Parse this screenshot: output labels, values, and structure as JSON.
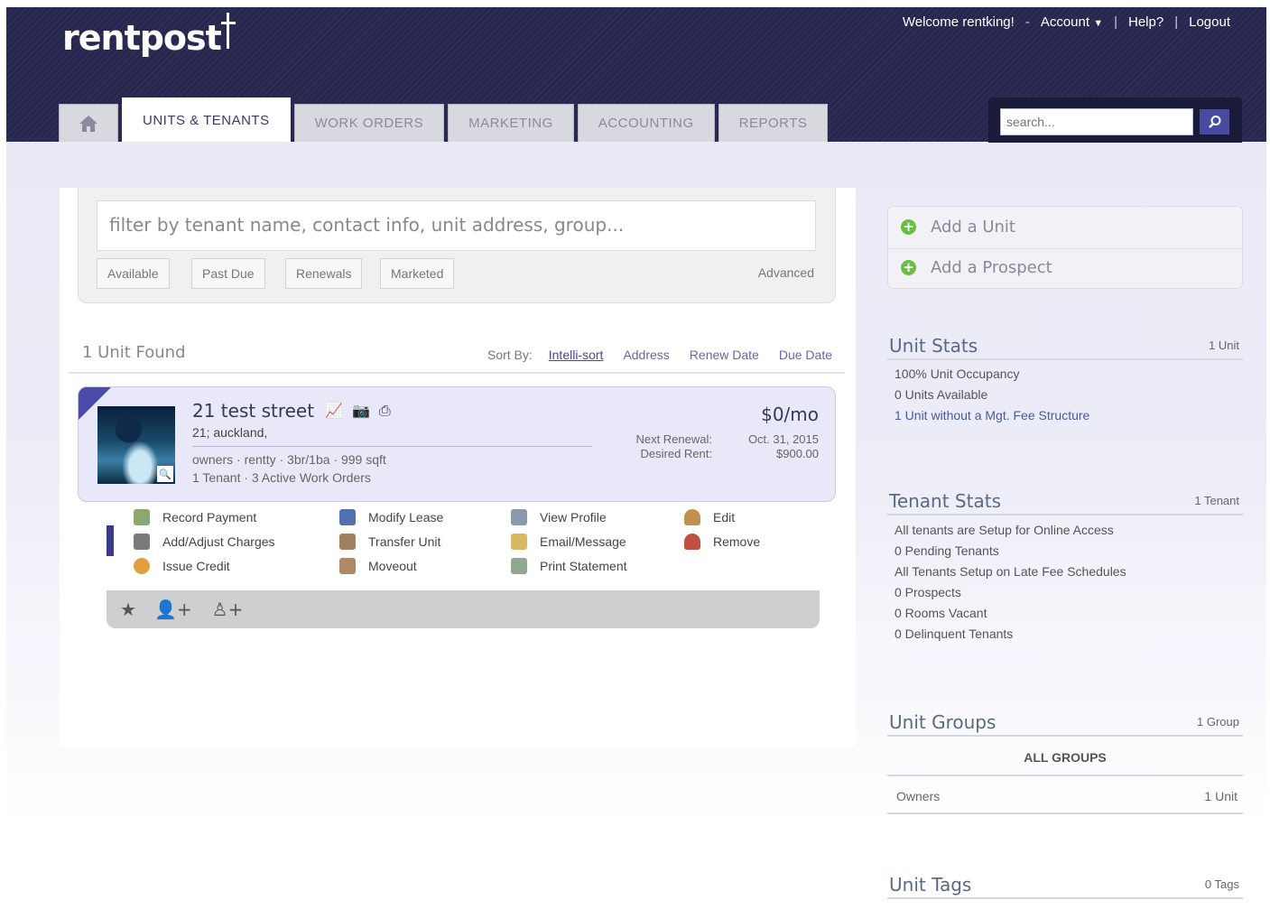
{
  "app": {
    "logo": "rentpost"
  },
  "topnav": {
    "welcome": "Welcome rentking!",
    "account": "Account",
    "help": "Help?",
    "logout": "Logout"
  },
  "tabs": [
    {
      "label": "UNITS & TENANTS"
    },
    {
      "label": "WORK ORDERS"
    },
    {
      "label": "MARKETING"
    },
    {
      "label": "ACCOUNTING"
    },
    {
      "label": "REPORTS"
    }
  ],
  "search": {
    "placeholder": "search..."
  },
  "filter": {
    "placeholder": "filter by tenant name, contact info, unit address, group...",
    "buttons": [
      "Available",
      "Past Due",
      "Renewals",
      "Marketed"
    ],
    "advanced": "Advanced"
  },
  "results": {
    "count_text": "1 Unit Found",
    "sort_label": "Sort By:",
    "sort_options": [
      "Intelli-sort",
      "Address",
      "Renew Date",
      "Due Date"
    ]
  },
  "unit": {
    "address": "21 test street",
    "city": "21; auckland,",
    "meta": "owners  ·  rentty  ·  3br/1ba  ·  999 sqft",
    "tenants": "1 Tenant  ·  3 Active Work Orders",
    "price": "$0/mo",
    "next_renewal_label": "Next Renewal:",
    "next_renewal_value": "Oct. 31, 2015",
    "desired_rent_label": "Desired Rent:",
    "desired_rent_value": "$900.00"
  },
  "actions": {
    "col1": [
      "Record Payment",
      "Add/Adjust Charges",
      "Issue Credit"
    ],
    "col2": [
      "Modify Lease",
      "Transfer Unit",
      "Moveout"
    ],
    "col3": [
      "View Profile",
      "Email/Message",
      "Print Statement"
    ],
    "col4": [
      "Edit",
      "Remove"
    ]
  },
  "sidebar": {
    "links": [
      "Add a Unit",
      "Add a Prospect"
    ],
    "unit_stats": {
      "title": "Unit Stats",
      "count": "1 Unit",
      "lines": [
        "100% Unit Occupancy",
        "0 Units Available",
        "1 Unit without a Mgt. Fee Structure"
      ]
    },
    "tenant_stats": {
      "title": "Tenant Stats",
      "count": "1 Tenant",
      "lines": [
        "All tenants are Setup for Online Access",
        "0 Pending Tenants",
        "All Tenants Setup on Late Fee Schedules",
        "0 Prospects",
        "0 Rooms Vacant",
        "0 Delinquent Tenants"
      ]
    },
    "unit_groups": {
      "title": "Unit Groups",
      "count": "1 Group",
      "all_groups": "ALL GROUPS",
      "group_name": "Owners",
      "group_count": "1 Unit"
    },
    "unit_tags": {
      "title": "Unit Tags",
      "count": "0 Tags"
    }
  },
  "colors": {
    "header": "#26264f",
    "accent": "#4a4aa0",
    "card": "#e8e8f8",
    "green_plus": "#6abf40"
  }
}
